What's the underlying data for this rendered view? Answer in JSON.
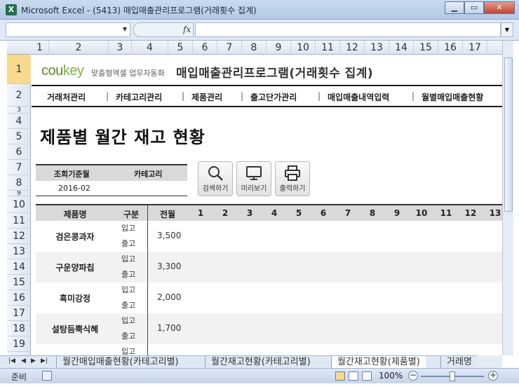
{
  "window": {
    "title": "Microsoft Excel - (5413) 매입매출관리프로그램(거래횟수 집계)",
    "logo_letter": "X",
    "minimize": "▁",
    "restore": "▭",
    "close": "✕"
  },
  "formula_bar": {
    "name_box": "",
    "fx": "fx",
    "formula": ""
  },
  "columns": [
    "1",
    "2",
    "3",
    "4",
    "5",
    "6",
    "7",
    "8",
    "9",
    "10",
    "11",
    "12",
    "13",
    "14",
    "15",
    "16",
    "17"
  ],
  "rows": [
    "1",
    "2",
    "3",
    "4",
    "5",
    "6",
    "7",
    "8",
    "9",
    "10",
    "11",
    "12",
    "13",
    "14",
    "15",
    "16",
    "17",
    "18",
    "19"
  ],
  "brand": {
    "name_co": "cou",
    "name_key": "key",
    "tagline": "맞춤형엑셀 업무자동화"
  },
  "app_title": "매입매출관리프로그램(거래횟수 집계)",
  "nav": [
    "거래처관리",
    "카테고리관리",
    "제품관리",
    "출고단가관리",
    "매입매출내역입력",
    "월별매입매출현황"
  ],
  "page_title": "제품별 월간 재고 현황",
  "filter": {
    "label_date": "조회기준월",
    "label_category": "카테고리",
    "value_date": "2016-02",
    "value_category": ""
  },
  "tools": {
    "search": "검색하기",
    "preview": "미리보기",
    "print": "출력하기"
  },
  "table": {
    "headers": {
      "name": "제품명",
      "type": "구분",
      "prev": "전월",
      "months": [
        "1",
        "2",
        "3",
        "4",
        "5",
        "6",
        "7",
        "8",
        "9",
        "10",
        "11",
        "12",
        "13"
      ]
    },
    "in_label": "입고",
    "out_label": "출고",
    "products": [
      {
        "name": "검은콩과자",
        "prev": "3,500"
      },
      {
        "name": "구운양파칩",
        "prev": "3,300"
      },
      {
        "name": "흑미강정",
        "prev": "2,000"
      },
      {
        "name": "설탕듬뿍식혜",
        "prev": "1,700"
      },
      {
        "name": "",
        "prev": ""
      }
    ]
  },
  "sheet_tabs": [
    "월간매입매출현황(카테고리별)",
    "월간재고현황(카테고리별)",
    "월간재고현황(제품별)",
    "거래명"
  ],
  "active_tab": 2,
  "status": {
    "ready": "준비",
    "zoom": "100%",
    "zoom_minus": "−",
    "zoom_plus": "+"
  }
}
